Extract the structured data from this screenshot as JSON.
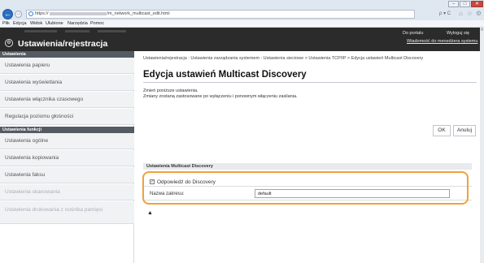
{
  "browser": {
    "url_prefix": "https://",
    "url_suffix": "/m_network_multicast_edit.html",
    "search_glyph": "ρ",
    "search_sep": "▾ C",
    "win_minimize": "–",
    "win_maximize": "□",
    "win_close": "✕",
    "back_glyph": "←",
    "forward_glyph": "→",
    "icons": [
      "home-icon",
      "star-icon",
      "gear-icon"
    ],
    "menu": [
      "Plik",
      "Edycja",
      "Widok",
      "Ulubione",
      "Narzędzia",
      "Pomoc"
    ]
  },
  "header": {
    "title": "Ustawienia/rejestracja",
    "icon_glyph": "⚙",
    "portal_link": "Do portalu",
    "logout_link": "Wyloguj się",
    "admin_message_link": "Wiadomość do menedżera systemu"
  },
  "sidebar": {
    "section1": "Ustawienia",
    "items1": [
      "Ustawienia papieru",
      "Ustawienia wyświetlania",
      "Ustawienia włącznika czasowego",
      "Regulacja poziomu głośności"
    ],
    "section2": "Ustawienia funkcji",
    "items2": [
      "Ustawienia ogólne",
      "Ustawienia kopiowania",
      "Ustawienia faksu",
      "Ustawienia skanowania",
      "Ustawienia drukowania z nośnika pamięci"
    ]
  },
  "main": {
    "breadcrumb": "Ustawienia/rejestracja : Ustawienia zarządzania systemem : Ustawienia sieciowe > Ustawienia TCP/IP > Edycja ustawień Multicast Discovery",
    "title": "Edycja ustawień Multicast Discovery",
    "note1": "Zmień poniższe ustawienia.",
    "note2": "Zmiany zostaną zastosowane po wyłączeniu i ponownym włączeniu zasilania.",
    "ok_label": "OK",
    "cancel_label": "Anuluj",
    "section_title": "Ustawienia Multicast Discovery",
    "discovery_checkbox_label": "Odpowiedź do Discovery",
    "discovery_checked": true,
    "checkmark": "✓",
    "scope_label": "Nazwa zakresu:",
    "scope_value": "default",
    "top_anchor": "▲"
  }
}
